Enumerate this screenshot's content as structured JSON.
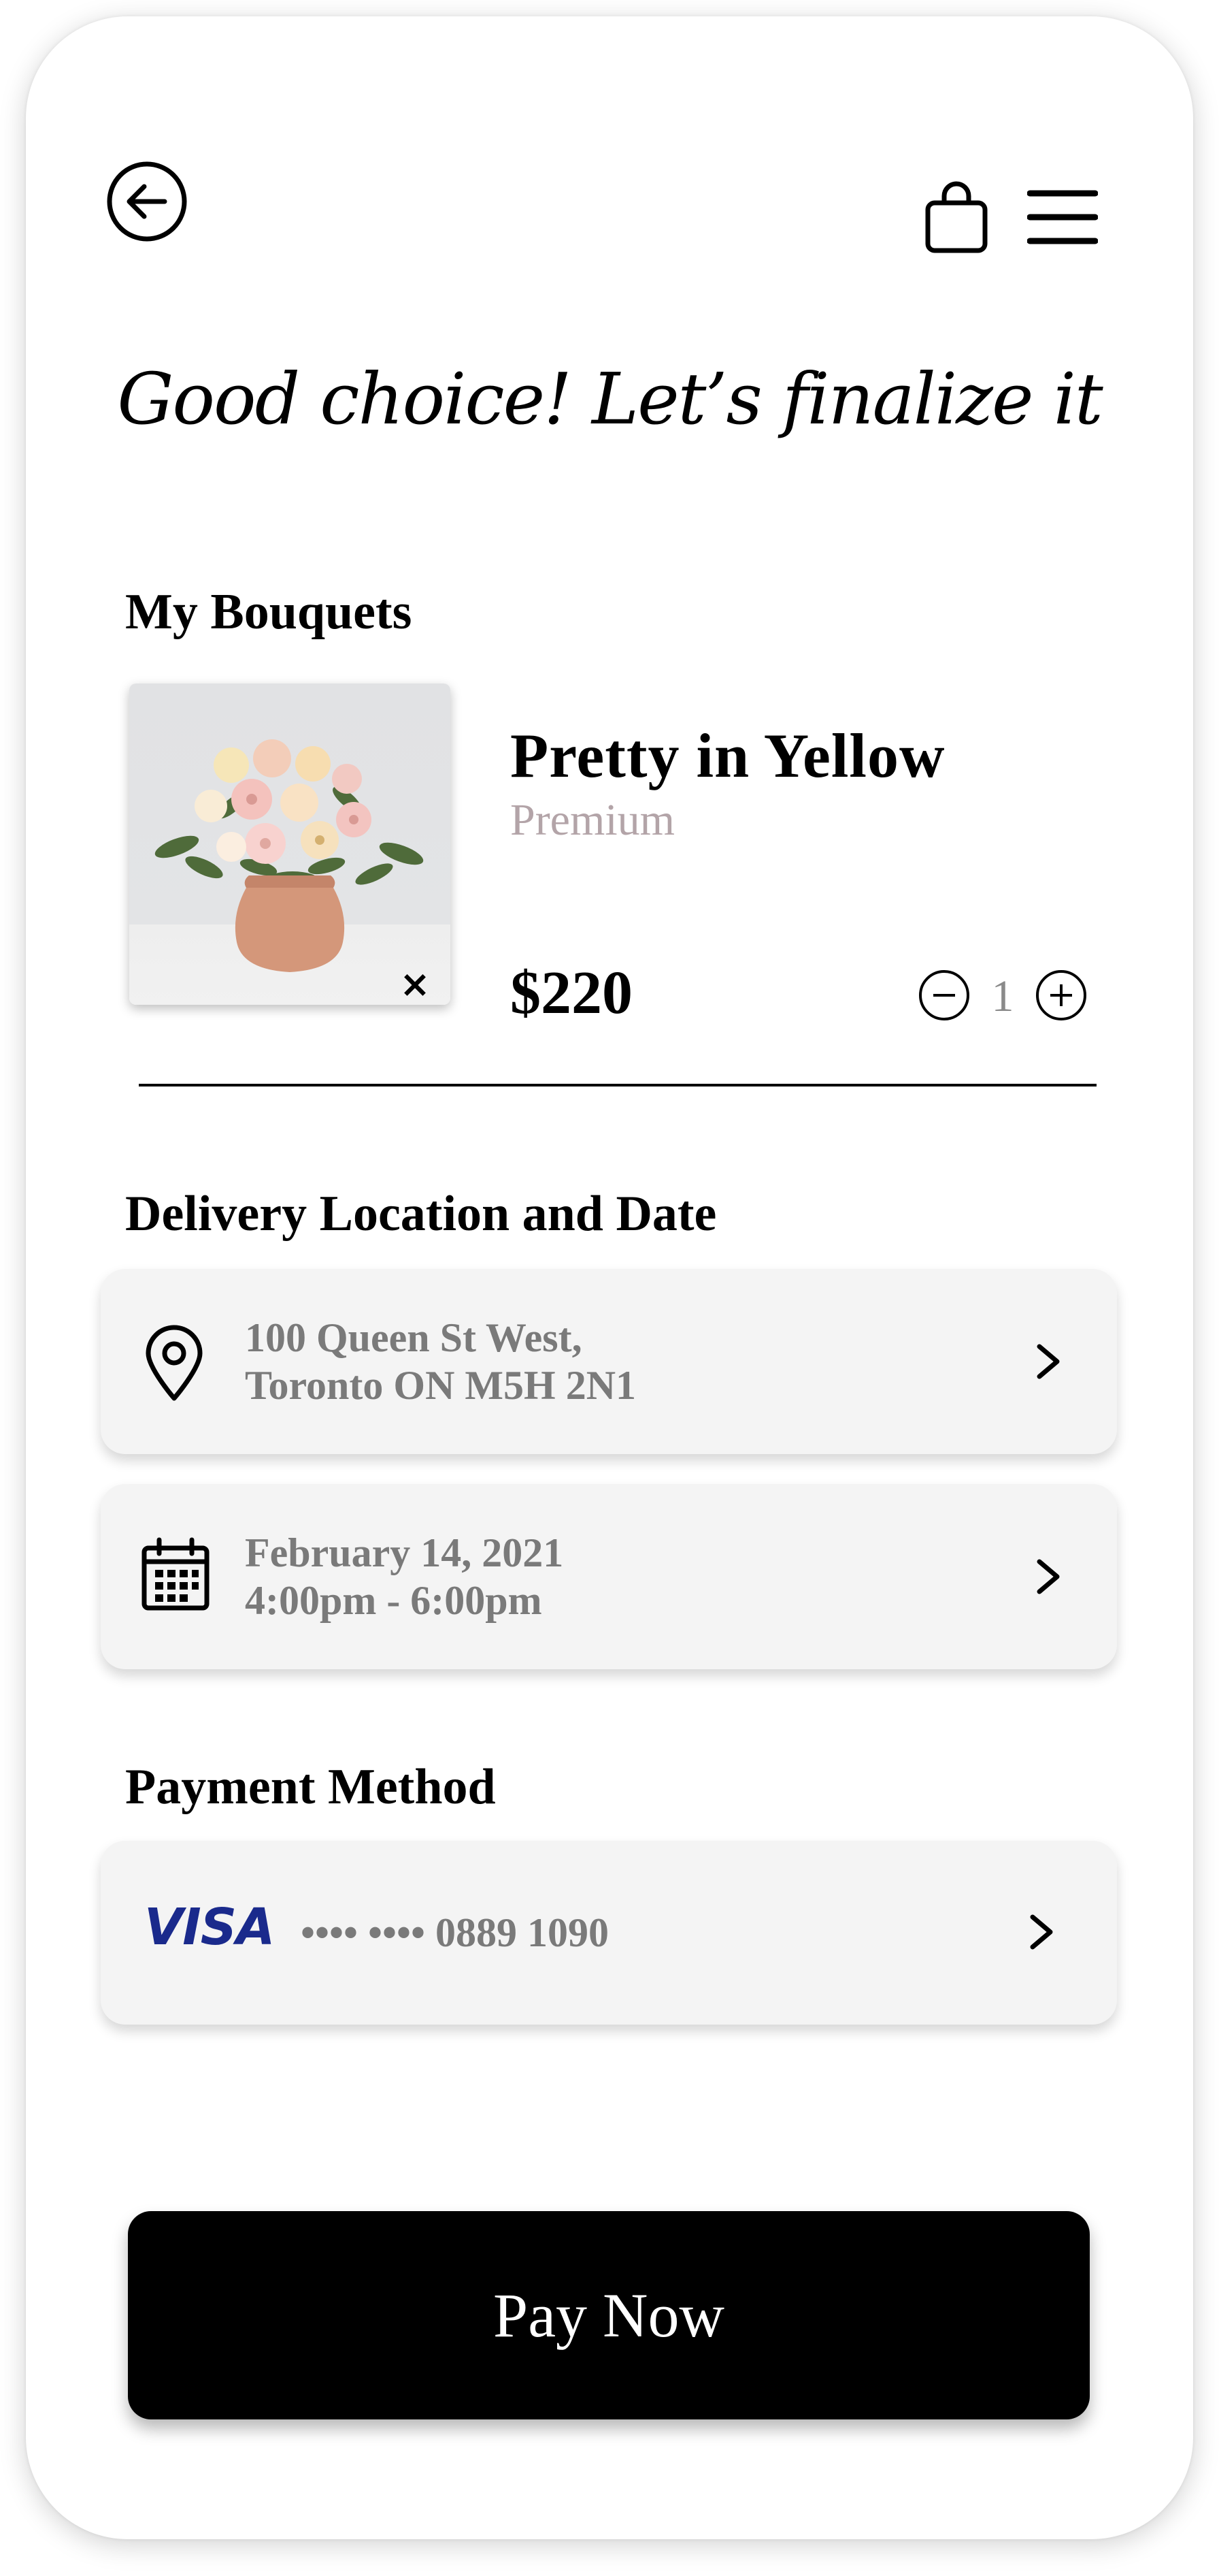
{
  "header": {
    "back_icon": "arrow-left-circle-icon",
    "bag_icon": "shopping-bag-icon",
    "menu_icon": "hamburger-menu-icon"
  },
  "headline": "Good choice! Let’s finalize it",
  "bouquets": {
    "title": "My Bouquets",
    "item": {
      "name": "Pretty in Yellow",
      "tier": "Premium",
      "price": "$220",
      "quantity": "1",
      "remove_label": "×",
      "image_icon": "flower-vase-photo"
    }
  },
  "delivery": {
    "title": "Delivery Location and Date",
    "address_line1": "100 Queen St West,",
    "address_line2": "Toronto ON M5H 2N1",
    "date": "February 14, 2021",
    "time": "4:00pm - 6:00pm"
  },
  "payment": {
    "title": "Payment Method",
    "brand": "VISA",
    "card_number": "•••• •••• 0889 1090"
  },
  "pay_button": "Pay Now",
  "colors": {
    "card_bg": "#f4f4f4",
    "muted_text": "#7a7a7a",
    "tier_text": "#b3a4a8",
    "visa_blue": "#1a2a8c",
    "button_bg": "#000000"
  }
}
